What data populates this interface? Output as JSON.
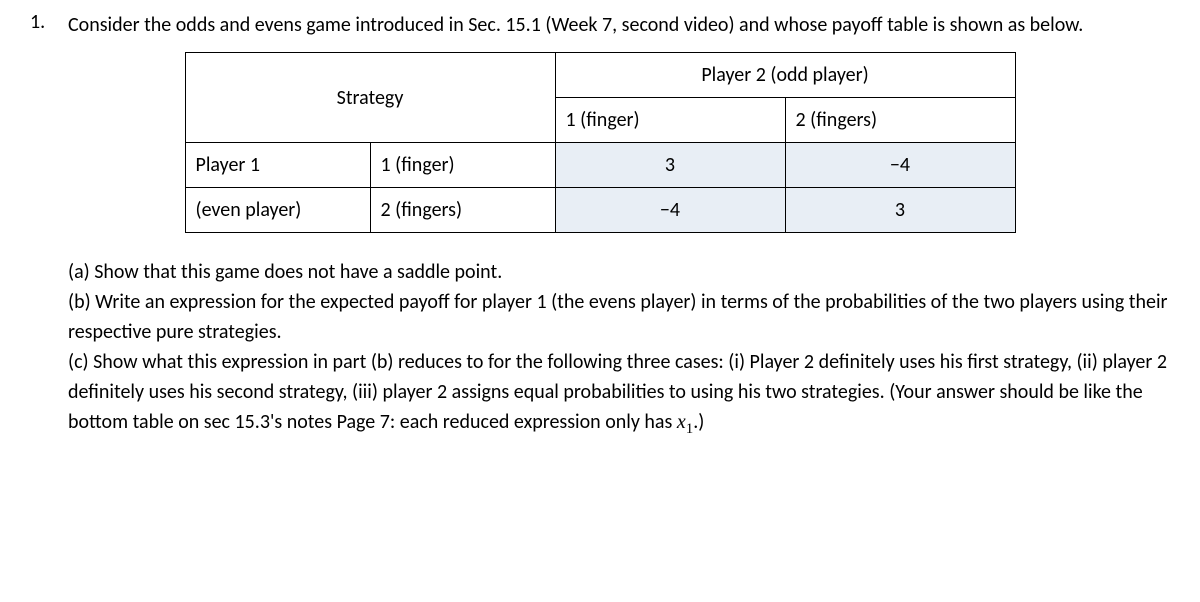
{
  "problem": {
    "number": "1.",
    "intro": "Consider the odds and evens game introduced in Sec. 15.1 (Week 7, second video) and whose payoff table is shown as below."
  },
  "table": {
    "strategy_label": "Strategy",
    "p2_header": "Player 2 (odd player)",
    "col1": "1 (finger)",
    "col2": "2 (fingers)",
    "p1_label_a": "Player 1",
    "p1_label_b": "(even player)",
    "row1_label": "1 (finger)",
    "row2_label": "2 (fingers)",
    "cells": {
      "r1c1": "3",
      "r1c2": "−4",
      "r2c1": "−4",
      "r2c2": "3"
    }
  },
  "subparts": {
    "a": "(a) Show that this game does not have a saddle point.",
    "b": "(b) Write an expression for the expected payoff for player 1 (the evens player) in terms of the probabilities of the two players using their respective pure strategies.",
    "c_prefix": "(c) Show what this expression in part (b) reduces to for the following three cases: (i) Player 2 definitely uses his first strategy, (ii) player 2 definitely uses his second strategy, (iii) player 2 assigns equal probabilities to using his two strategies. (Your answer should be like the bottom table on sec 15.3's notes Page 7: each reduced expression only has ",
    "c_var": "x",
    "c_sub": "1",
    "c_suffix": ".)"
  },
  "chart_data": {
    "type": "table",
    "title": "Odds and Evens Game Payoff Matrix (payoffs to Player 1)",
    "row_player": "Player 1 (even player)",
    "column_player": "Player 2 (odd player)",
    "row_strategies": [
      "1 (finger)",
      "2 (fingers)"
    ],
    "column_strategies": [
      "1 (finger)",
      "2 (fingers)"
    ],
    "payoffs": [
      [
        3,
        -4
      ],
      [
        -4,
        3
      ]
    ]
  }
}
